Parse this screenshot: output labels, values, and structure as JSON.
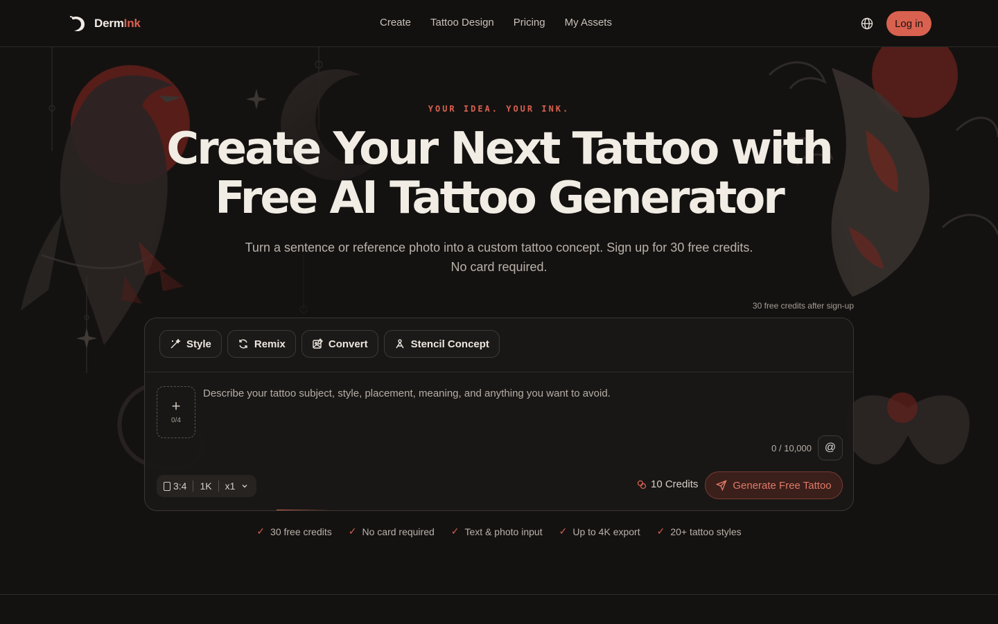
{
  "header": {
    "logo_text_main": "Derm",
    "logo_text_accent": "Ink",
    "nav": [
      "Create",
      "Tattoo Design",
      "Pricing",
      "My Assets"
    ],
    "language_icon": "globe-icon",
    "login_label": "Log in"
  },
  "hero": {
    "eyebrow": "YOUR IDEA. YOUR INK.",
    "title_line1": "Create Your Next Tattoo with",
    "title_line2": "Free AI Tattoo Generator",
    "subtitle": "Turn a sentence or reference photo into a custom tattoo concept. Sign up for 30 free credits. No card required.",
    "credits_note": "30 free credits after sign-up"
  },
  "generator": {
    "modes": [
      {
        "label": "Style",
        "icon": "magic-wand-icon"
      },
      {
        "label": "Remix",
        "icon": "refresh-icon"
      },
      {
        "label": "Convert",
        "icon": "image-edit-icon"
      },
      {
        "label": "Stencil Concept",
        "icon": "pen-tool-icon"
      }
    ],
    "upload_count": "0/4",
    "prompt_placeholder": "Describe your tattoo subject, style, placement, meaning, and anything you want to avoid.",
    "char_count": "0 / 10,000",
    "mention_symbol": "@",
    "options": {
      "ratio": "3:4",
      "resolution": "1K",
      "quantity": "x1"
    },
    "cost": "10 Credits",
    "generate_label": "Generate Free Tattoo"
  },
  "features": [
    "30 free credits",
    "No card required",
    "Text & photo input",
    "Up to 4K export",
    "20+ tattoo styles"
  ],
  "colors": {
    "accent": "#d9614f",
    "background": "#141211",
    "text": "#f1ece4"
  }
}
